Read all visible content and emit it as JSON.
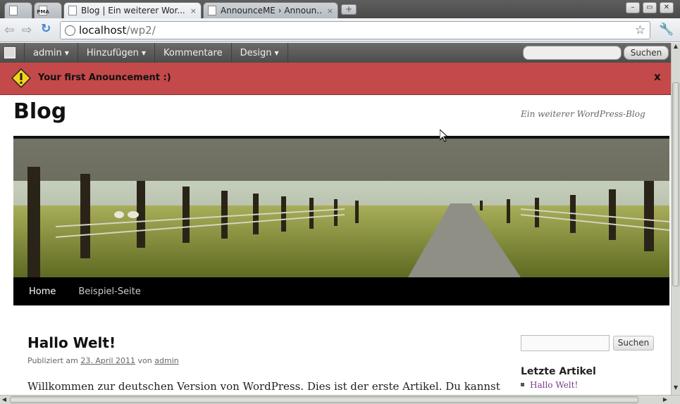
{
  "browser": {
    "tabs": [
      {
        "title": "",
        "favicon": "page-icon"
      },
      {
        "title": "",
        "favicon": "pma-icon",
        "favicon_text": "PMA"
      },
      {
        "title": "Blog | Ein weiterer Wor...",
        "favicon": "page-icon",
        "active": true,
        "close": "×"
      },
      {
        "title": "AnnounceME › Announ...",
        "favicon": "page-icon",
        "close": "×"
      }
    ],
    "new_tab_label": "+",
    "window_controls": {
      "minimize": "–",
      "maximize": "▭",
      "close": "✕"
    },
    "back_icon": "⇦",
    "forward_icon": "⇨",
    "reload_icon": "↻",
    "url_host": "localhost",
    "url_path": "/wp2/",
    "bookmark_icon": "☆",
    "menu_icon": "🔧"
  },
  "adminbar": {
    "items": [
      {
        "label": "admin",
        "caret": "▼"
      },
      {
        "label": "Hinzufügen",
        "caret": "▼"
      },
      {
        "label": "Kommentare",
        "caret": ""
      },
      {
        "label": "Design",
        "caret": "▼"
      }
    ],
    "search_button": "Suchen"
  },
  "announcement": {
    "text": "Your first Anouncement :)",
    "close": "x",
    "background": "#c4494a"
  },
  "site": {
    "title": "Blog",
    "tagline": "Ein weiterer WordPress-Blog",
    "nav": [
      {
        "label": "Home",
        "current": true
      },
      {
        "label": "Beispiel-Seite",
        "current": false
      }
    ]
  },
  "post": {
    "title": "Hallo Welt!",
    "meta_prefix": "Publiziert am",
    "date": "23. April 2011",
    "meta_by": "von",
    "author": "admin",
    "body": "Willkommen zur deutschen Version von WordPress. Dies ist der erste Artikel. Du kannst"
  },
  "sidebar": {
    "search_button": "Suchen",
    "recent_title": "Letzte Artikel",
    "recent_items": [
      "Hallo Welt!"
    ]
  }
}
